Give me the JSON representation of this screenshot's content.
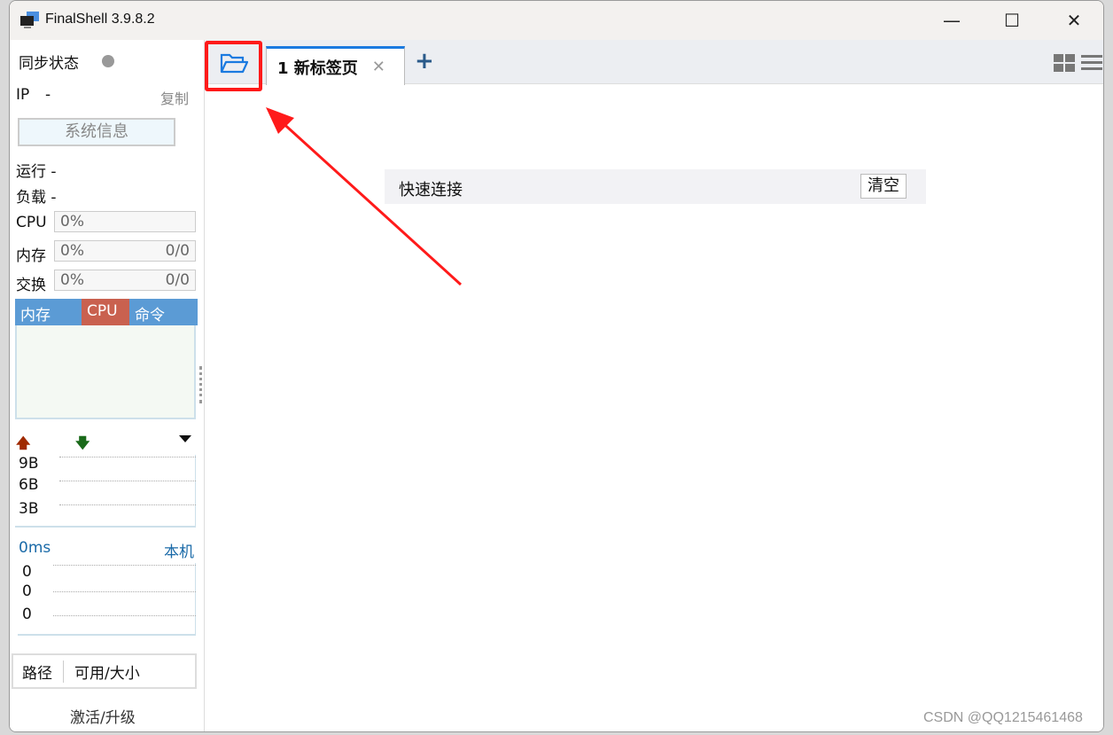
{
  "window": {
    "title": "FinalShell 3.9.8.2"
  },
  "sidebar": {
    "sync_label": "同步状态",
    "ip_label": "IP",
    "ip_value": "-",
    "copy": "复制",
    "sysinfo": "系统信息",
    "uptime_label": "运行",
    "uptime_value": "-",
    "load_label": "负载",
    "load_value": "-",
    "cpu_label": "CPU",
    "cpu_value": "0%",
    "mem_label": "内存",
    "mem_value": "0%",
    "mem_size": "0/0",
    "swap_label": "交换",
    "swap_value": "0%",
    "swap_size": "0/0",
    "proc_tabs": [
      {
        "label": "内存"
      },
      {
        "label": "CPU"
      },
      {
        "label": "命令"
      }
    ],
    "net_ticks": [
      "9B",
      "6B",
      "3B"
    ],
    "latency": "0ms",
    "host": "本机",
    "latency_ticks": [
      "0",
      "0",
      "0"
    ],
    "disk_cols": [
      "路径",
      "可用/大小"
    ],
    "activate": "激活/升级"
  },
  "tabs": {
    "items": [
      {
        "label": "1 新标签页"
      }
    ],
    "add": "+"
  },
  "quick_connect": {
    "label": "快速连接",
    "clear": "清空"
  },
  "watermark": "CSDN @QQ1215461468",
  "colors": {
    "accent": "#1a7ae0",
    "cpu_tab": "#c9614f",
    "proc_tab": "#5b9bd5",
    "highlight": "#ff1a1a"
  }
}
